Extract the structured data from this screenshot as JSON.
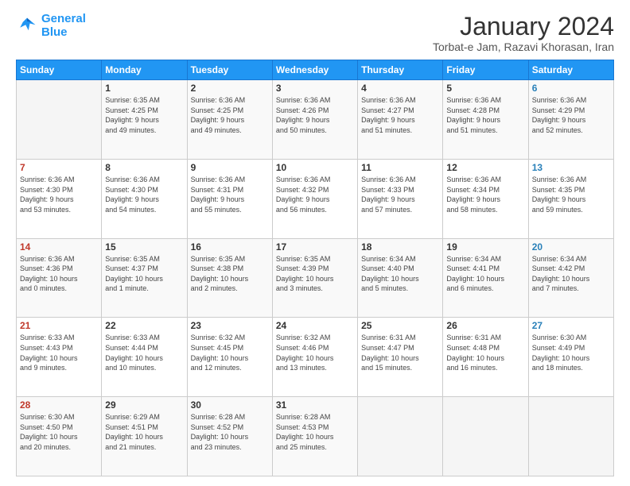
{
  "logo": {
    "line1": "General",
    "line2": "Blue"
  },
  "title": "January 2024",
  "subtitle": "Torbat-e Jam, Razavi Khorasan, Iran",
  "days_header": [
    "Sunday",
    "Monday",
    "Tuesday",
    "Wednesday",
    "Thursday",
    "Friday",
    "Saturday"
  ],
  "weeks": [
    [
      {
        "num": "",
        "info": ""
      },
      {
        "num": "1",
        "info": "Sunrise: 6:35 AM\nSunset: 4:25 PM\nDaylight: 9 hours\nand 49 minutes."
      },
      {
        "num": "2",
        "info": "Sunrise: 6:36 AM\nSunset: 4:25 PM\nDaylight: 9 hours\nand 49 minutes."
      },
      {
        "num": "3",
        "info": "Sunrise: 6:36 AM\nSunset: 4:26 PM\nDaylight: 9 hours\nand 50 minutes."
      },
      {
        "num": "4",
        "info": "Sunrise: 6:36 AM\nSunset: 4:27 PM\nDaylight: 9 hours\nand 51 minutes."
      },
      {
        "num": "5",
        "info": "Sunrise: 6:36 AM\nSunset: 4:28 PM\nDaylight: 9 hours\nand 51 minutes."
      },
      {
        "num": "6",
        "info": "Sunrise: 6:36 AM\nSunset: 4:29 PM\nDaylight: 9 hours\nand 52 minutes."
      }
    ],
    [
      {
        "num": "7",
        "info": "Sunrise: 6:36 AM\nSunset: 4:30 PM\nDaylight: 9 hours\nand 53 minutes."
      },
      {
        "num": "8",
        "info": "Sunrise: 6:36 AM\nSunset: 4:30 PM\nDaylight: 9 hours\nand 54 minutes."
      },
      {
        "num": "9",
        "info": "Sunrise: 6:36 AM\nSunset: 4:31 PM\nDaylight: 9 hours\nand 55 minutes."
      },
      {
        "num": "10",
        "info": "Sunrise: 6:36 AM\nSunset: 4:32 PM\nDaylight: 9 hours\nand 56 minutes."
      },
      {
        "num": "11",
        "info": "Sunrise: 6:36 AM\nSunset: 4:33 PM\nDaylight: 9 hours\nand 57 minutes."
      },
      {
        "num": "12",
        "info": "Sunrise: 6:36 AM\nSunset: 4:34 PM\nDaylight: 9 hours\nand 58 minutes."
      },
      {
        "num": "13",
        "info": "Sunrise: 6:36 AM\nSunset: 4:35 PM\nDaylight: 9 hours\nand 59 minutes."
      }
    ],
    [
      {
        "num": "14",
        "info": "Sunrise: 6:36 AM\nSunset: 4:36 PM\nDaylight: 10 hours\nand 0 minutes."
      },
      {
        "num": "15",
        "info": "Sunrise: 6:35 AM\nSunset: 4:37 PM\nDaylight: 10 hours\nand 1 minute."
      },
      {
        "num": "16",
        "info": "Sunrise: 6:35 AM\nSunset: 4:38 PM\nDaylight: 10 hours\nand 2 minutes."
      },
      {
        "num": "17",
        "info": "Sunrise: 6:35 AM\nSunset: 4:39 PM\nDaylight: 10 hours\nand 3 minutes."
      },
      {
        "num": "18",
        "info": "Sunrise: 6:34 AM\nSunset: 4:40 PM\nDaylight: 10 hours\nand 5 minutes."
      },
      {
        "num": "19",
        "info": "Sunrise: 6:34 AM\nSunset: 4:41 PM\nDaylight: 10 hours\nand 6 minutes."
      },
      {
        "num": "20",
        "info": "Sunrise: 6:34 AM\nSunset: 4:42 PM\nDaylight: 10 hours\nand 7 minutes."
      }
    ],
    [
      {
        "num": "21",
        "info": "Sunrise: 6:33 AM\nSunset: 4:43 PM\nDaylight: 10 hours\nand 9 minutes."
      },
      {
        "num": "22",
        "info": "Sunrise: 6:33 AM\nSunset: 4:44 PM\nDaylight: 10 hours\nand 10 minutes."
      },
      {
        "num": "23",
        "info": "Sunrise: 6:32 AM\nSunset: 4:45 PM\nDaylight: 10 hours\nand 12 minutes."
      },
      {
        "num": "24",
        "info": "Sunrise: 6:32 AM\nSunset: 4:46 PM\nDaylight: 10 hours\nand 13 minutes."
      },
      {
        "num": "25",
        "info": "Sunrise: 6:31 AM\nSunset: 4:47 PM\nDaylight: 10 hours\nand 15 minutes."
      },
      {
        "num": "26",
        "info": "Sunrise: 6:31 AM\nSunset: 4:48 PM\nDaylight: 10 hours\nand 16 minutes."
      },
      {
        "num": "27",
        "info": "Sunrise: 6:30 AM\nSunset: 4:49 PM\nDaylight: 10 hours\nand 18 minutes."
      }
    ],
    [
      {
        "num": "28",
        "info": "Sunrise: 6:30 AM\nSunset: 4:50 PM\nDaylight: 10 hours\nand 20 minutes."
      },
      {
        "num": "29",
        "info": "Sunrise: 6:29 AM\nSunset: 4:51 PM\nDaylight: 10 hours\nand 21 minutes."
      },
      {
        "num": "30",
        "info": "Sunrise: 6:28 AM\nSunset: 4:52 PM\nDaylight: 10 hours\nand 23 minutes."
      },
      {
        "num": "31",
        "info": "Sunrise: 6:28 AM\nSunset: 4:53 PM\nDaylight: 10 hours\nand 25 minutes."
      },
      {
        "num": "",
        "info": ""
      },
      {
        "num": "",
        "info": ""
      },
      {
        "num": "",
        "info": ""
      }
    ]
  ]
}
